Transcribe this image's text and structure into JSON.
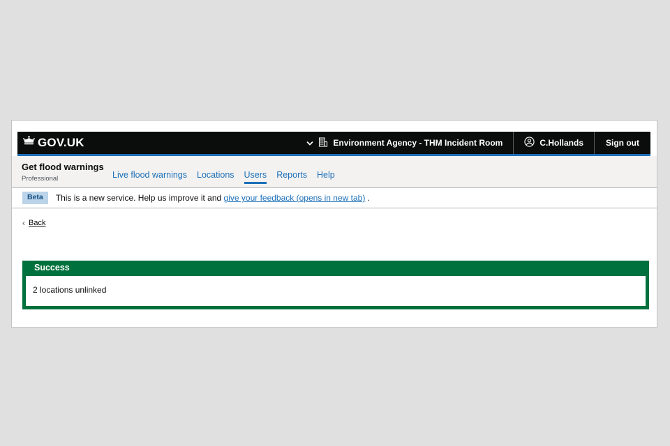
{
  "header": {
    "logo_text": "GOV.UK",
    "org_label": "Environment Agency - THM Incident Room",
    "user_name": "C.Hollands",
    "sign_out_label": "Sign out",
    "bar_color": "#0b0c0c",
    "accent_color": "#1d70b8"
  },
  "service_nav": {
    "service_name": "Get flood warnings",
    "service_tag": "Professional",
    "items": [
      {
        "label": "Live flood warnings",
        "active": false
      },
      {
        "label": "Locations",
        "active": false
      },
      {
        "label": "Users",
        "active": true
      },
      {
        "label": "Reports",
        "active": false
      },
      {
        "label": "Help",
        "active": false
      }
    ]
  },
  "phase_banner": {
    "tag": "Beta",
    "text_before_link": "This is a new service. Help us improve it and",
    "link_label": "give your feedback (opens in new tab)",
    "text_after_link": "."
  },
  "back_link": {
    "chevron": "‹",
    "label": "Back"
  },
  "notification": {
    "title": "Success",
    "message": "2 locations unlinked",
    "accent_color": "#00703c"
  }
}
